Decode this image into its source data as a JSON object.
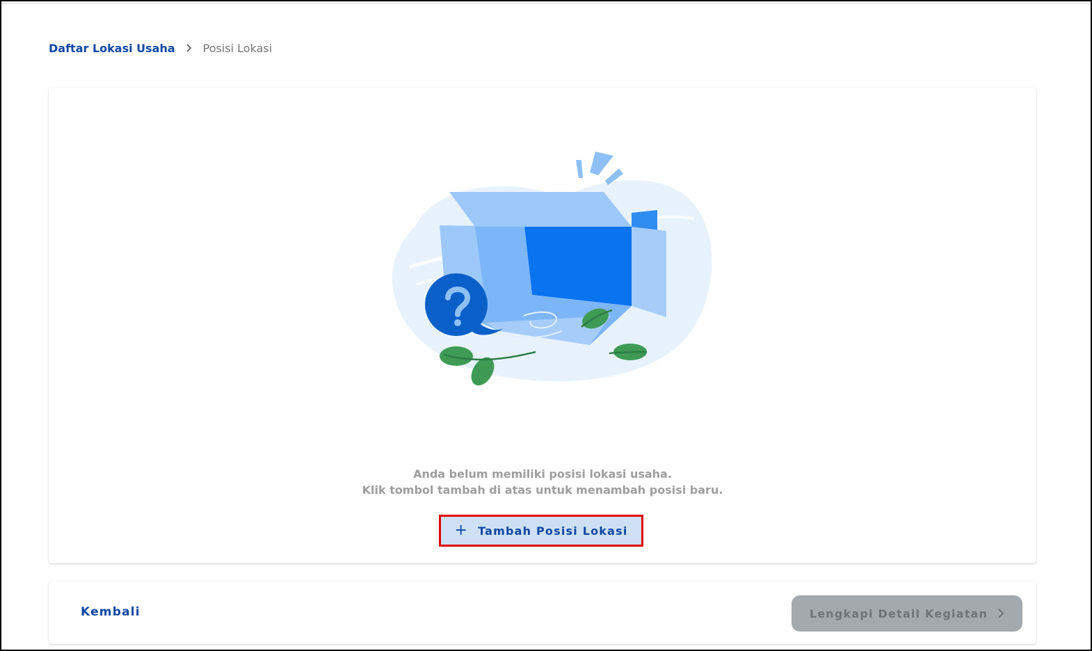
{
  "breadcrumb": {
    "parent_label": "Daftar Lokasi Usaha",
    "current_label": "Posisi Lokasi",
    "separator_icon": "chevron-right-icon"
  },
  "empty_state": {
    "illustration": "empty-box-illustration",
    "line1": "Anda belum memiliki posisi lokasi usaha.",
    "line2": "Klik tombol tambah di atas untuk menambah posisi baru.",
    "add_button_label": "Tambah Posisi Lokasi",
    "add_button_icon": "plus-icon"
  },
  "footer": {
    "back_label": "Kembali",
    "next_label": "Lengkapi Detail Kegiatan",
    "next_icon": "chevron-right-icon",
    "next_disabled": true
  },
  "colors": {
    "primary": "#0d47a1",
    "highlight_border": "#e00000",
    "button_bg": "#cfe0f4",
    "disabled_bg": "#a3a9ad",
    "muted_text": "#9e9e9e"
  }
}
